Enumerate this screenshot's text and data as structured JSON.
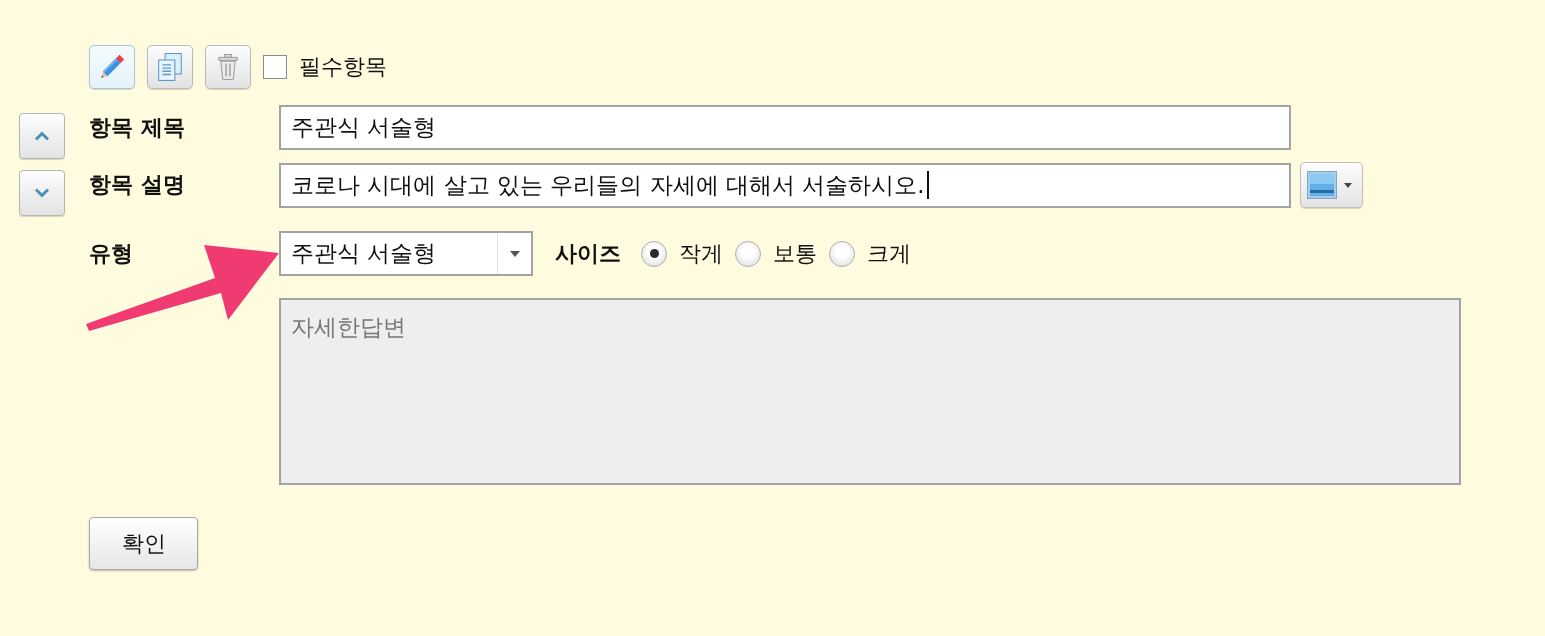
{
  "toolbar": {
    "buttons": [
      {
        "kind": "edit",
        "selected": true
      },
      {
        "kind": "copy",
        "selected": false
      },
      {
        "kind": "delete",
        "selected": false
      }
    ],
    "required_checkbox": {
      "label": "필수항목",
      "checked": false
    }
  },
  "move_buttons": [
    {
      "kind": "up"
    },
    {
      "kind": "down"
    }
  ],
  "title_row": {
    "label": "항목 제목",
    "value": "주관식 서술형"
  },
  "description_row": {
    "label": "항목 설명",
    "value": "코로나 시대에 살고 있는 우리들의 자세에 대해서 서술하시오.",
    "focused": true,
    "color_picker": true
  },
  "type_row": {
    "label": "유형",
    "selected_type": "주관식 서술형",
    "size_label": "사이즈",
    "size_options": [
      {
        "label": "작게",
        "selected": true
      },
      {
        "label": "보통",
        "selected": false
      },
      {
        "label": "크게",
        "selected": false
      }
    ]
  },
  "answer_box": {
    "placeholder": "자세한답변",
    "disabled": true
  },
  "confirm_button": {
    "label": "확인"
  }
}
